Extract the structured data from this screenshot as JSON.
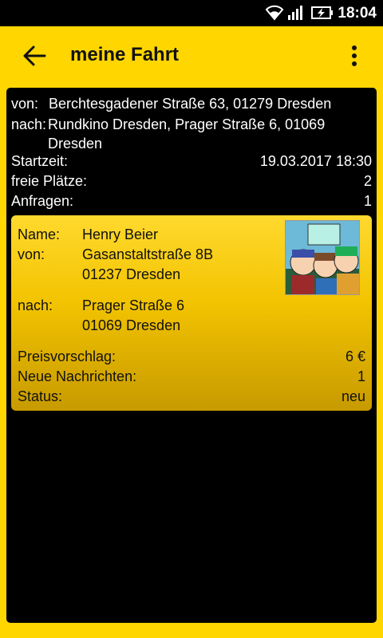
{
  "status_bar": {
    "time": "18:04"
  },
  "app_bar": {
    "title": "meine Fahrt"
  },
  "ride": {
    "from_label": "von:",
    "from_value": "Berchtesgadener Straße 63, 01279 Dresden",
    "to_label": "nach:",
    "to_value": "Rundkino Dresden, Prager Straße 6, 01069 Dresden",
    "start_label": "Startzeit:",
    "start_value": "19.03.2017 18:30",
    "seats_label": "freie Plätze:",
    "seats_value": "2",
    "requests_label": "Anfragen:",
    "requests_value": "1"
  },
  "request_card": {
    "name_label": "Name:",
    "name_value": "Henry Beier",
    "from_label": "von:",
    "from_line1": "Gasanstaltstraße 8B",
    "from_line2": "01237 Dresden",
    "to_label": "nach:",
    "to_line1": "Prager Straße 6",
    "to_line2": "01069 Dresden",
    "price_label": "Preisvorschlag:",
    "price_value": "6 €",
    "messages_label": "Neue Nachrichten:",
    "messages_value": "1",
    "status_label": "Status:",
    "status_value": "neu"
  },
  "icons": [
    "wifi-icon",
    "signal-icon",
    "battery-charging-icon",
    "back-arrow-icon",
    "overflow-menu-icon",
    "avatar-image"
  ],
  "colors": {
    "accent": "#ffd600",
    "panel": "#000000",
    "card_top": "#ffd92e",
    "card_bottom": "#c79a00"
  }
}
